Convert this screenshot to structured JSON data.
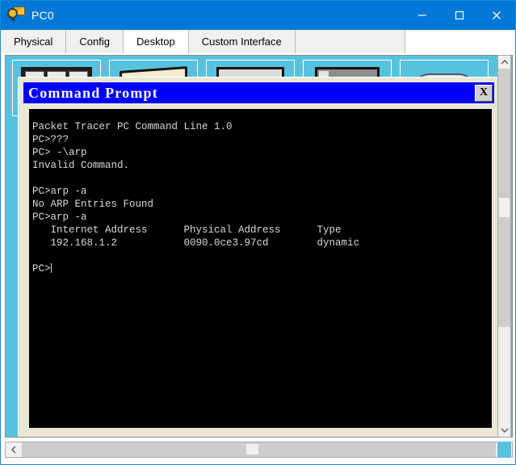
{
  "window": {
    "title": "PC0",
    "icon": "packet-tracer-icon",
    "controls": {
      "minimize": "minimize-icon",
      "maximize": "maximize-icon",
      "close": "close-icon"
    },
    "title_bar_color": "#0078d7"
  },
  "tabs": [
    {
      "label": "Physical",
      "active": false
    },
    {
      "label": "Config",
      "active": false
    },
    {
      "label": "Desktop",
      "active": true
    },
    {
      "label": "Custom Interface",
      "active": false
    }
  ],
  "desktop": {
    "background_color": "#57c2dd",
    "icons": [
      {
        "name": "monitors-icon"
      },
      {
        "name": "folder-icon"
      },
      {
        "name": "screen-icon"
      },
      {
        "name": "laptop-icon"
      },
      {
        "name": "cloud-icon"
      }
    ]
  },
  "command_prompt": {
    "title": "Command Prompt",
    "title_bar_color": "#0000ff",
    "close_label": "X",
    "background_color": "#000000",
    "text_color": "#d8d8d8",
    "lines": [
      "Packet Tracer PC Command Line 1.0",
      "PC>???",
      "PC> -\\arp",
      "Invalid Command.",
      "",
      "PC>arp -a",
      "No ARP Entries Found",
      "PC>arp -a",
      "   Internet Address      Physical Address      Type",
      "   192.168.1.2           0090.0ce3.97cd        dynamic",
      "",
      "PC>"
    ],
    "arp_table": {
      "headers": [
        "Internet Address",
        "Physical Address",
        "Type"
      ],
      "rows": [
        [
          "192.168.1.2",
          "0090.0ce3.97cd",
          "dynamic"
        ]
      ]
    },
    "prompt": "PC>"
  },
  "scrollbars": {
    "vertical": {
      "up": "chevron-up-icon",
      "down": "chevron-down-icon"
    },
    "horizontal": {
      "left": "chevron-left-icon",
      "right": "chevron-right-icon"
    }
  }
}
